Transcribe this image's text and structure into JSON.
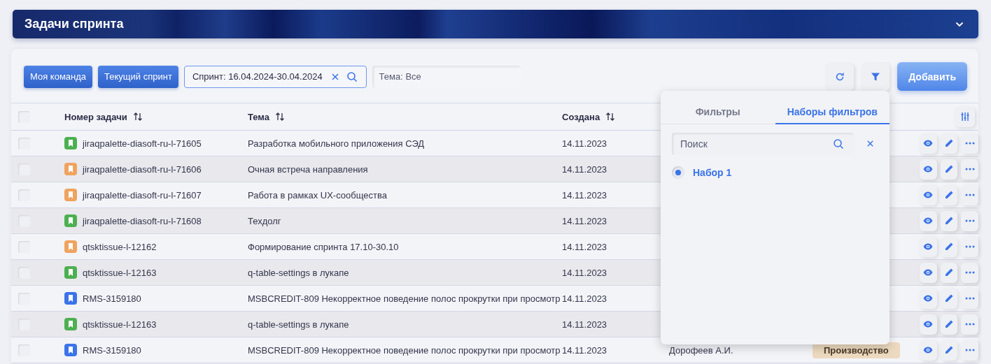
{
  "header": {
    "title": "Задачи спринта",
    "expanded": true
  },
  "toolbar": {
    "chips": [
      {
        "label": "Моя команда",
        "selected": true
      },
      {
        "label": "Текущий спринт",
        "selected": true
      }
    ],
    "sprint_field": {
      "value": "Спринт: 16.04.2024-30.04.2024"
    },
    "theme_field": {
      "value": "Тема: Все"
    },
    "add_button": "Добавить"
  },
  "table": {
    "select_all": false,
    "columns": [
      {
        "label": "Номер задачи",
        "sortable": true
      },
      {
        "label": "Тема",
        "sortable": true
      },
      {
        "label": "Создана",
        "sortable": true
      }
    ],
    "rows": [
      {
        "checked": false,
        "color": "#4caf50",
        "id": "jiraqpalette-diasoft-ru-l-71605",
        "theme": "Разработка мобильного приложения СЭД",
        "created": "14.11.2023"
      },
      {
        "checked": false,
        "color": "#f0a35e",
        "id": "jiraqpalette-diasoft-ru-l-71606",
        "theme": "Очная встреча направления",
        "created": "14.11.2023"
      },
      {
        "checked": false,
        "color": "#f0a35e",
        "id": "jiraqpalette-diasoft-ru-l-71607",
        "theme": "Работа в рамках UX-сообщества",
        "created": "14.11.2023"
      },
      {
        "checked": false,
        "color": "#4caf50",
        "id": "jiraqpalette-diasoft-ru-l-71608",
        "theme": "Техдолг",
        "created": "14.11.2023"
      },
      {
        "checked": false,
        "color": "#f0a35e",
        "id": "qtsktissue-l-12162",
        "theme": "Формирование спринта 17.10-30.10",
        "created": "14.11.2023"
      },
      {
        "checked": false,
        "color": "#4caf50",
        "id": "qtsktissue-l-12163",
        "theme": "q-table-settings в лукапе",
        "created": "14.11.2023"
      },
      {
        "checked": false,
        "color": "#3b73e8",
        "id": "RMS-3159180",
        "theme": "MSBCREDIT-809 Некорректное поведение полос прокрутки при просмотр",
        "created": "14.11.2023"
      },
      {
        "checked": false,
        "color": "#4caf50",
        "id": "qtsktissue-l-12163",
        "theme": "q-table-settings в лукапе",
        "created": "14.11.2023"
      },
      {
        "checked": false,
        "color": "#3b73e8",
        "id": "RMS-3159180",
        "theme": "MSBCREDIT-809 Некорректное поведение полос прокрутки при просмотр",
        "created": "14.11.2023",
        "assignee": "Дорофеев А.И.",
        "status": "Производство"
      }
    ]
  },
  "filter_popover": {
    "tabs": [
      {
        "label": "Фильтры",
        "selected": false
      },
      {
        "label": "Наборы фильтров",
        "selected": true
      }
    ],
    "search": {
      "placeholder": "Поиск"
    },
    "sets": [
      {
        "label": "Набор 1",
        "selected": true
      }
    ]
  }
}
